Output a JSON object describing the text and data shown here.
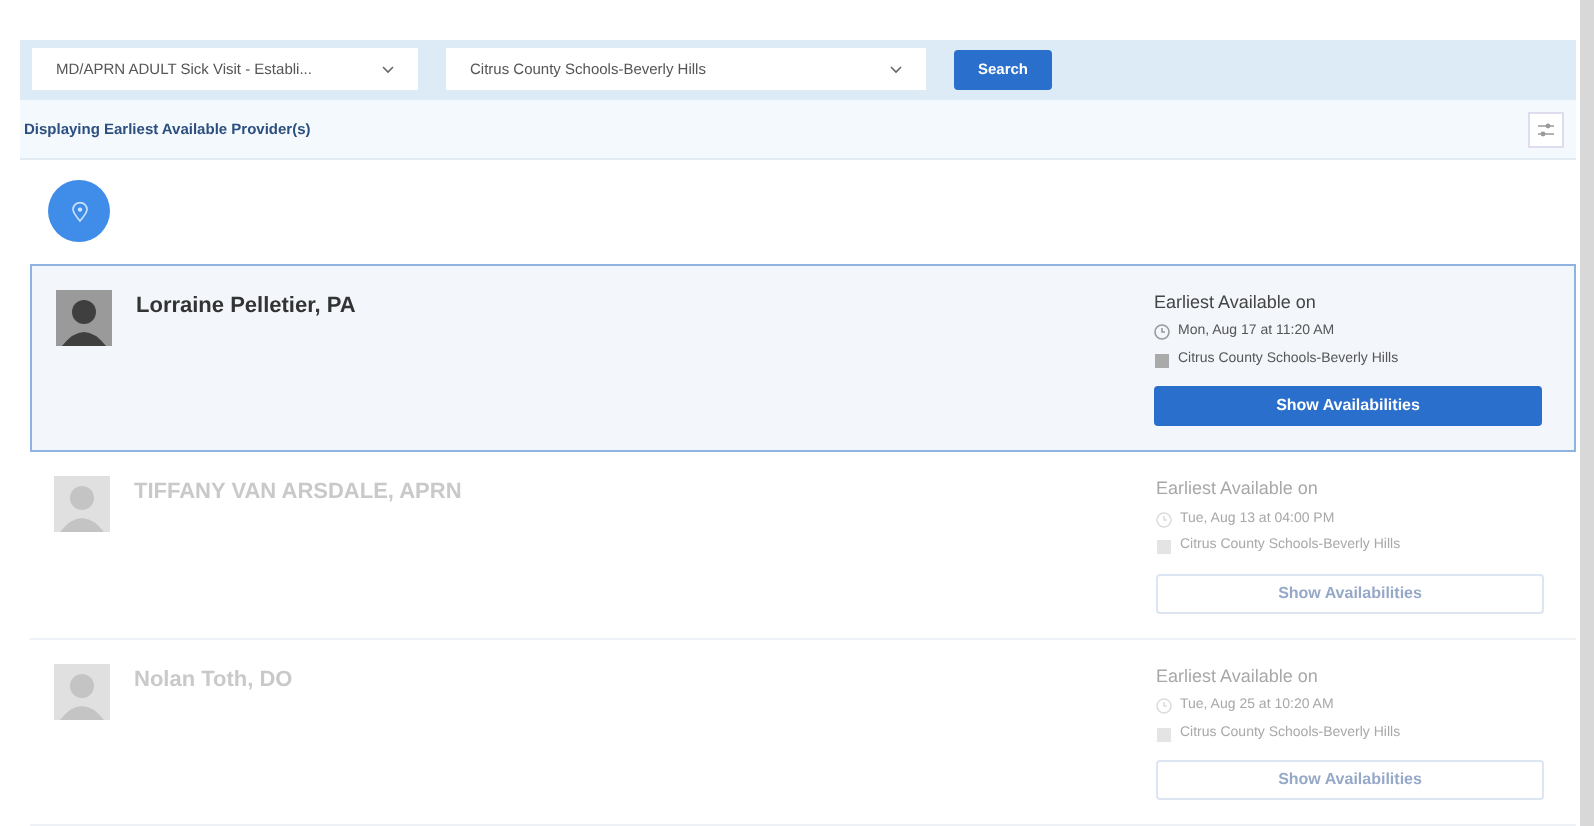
{
  "filters": {
    "visit_type": "MD/APRN ADULT Sick Visit - Establi...",
    "location": "Citrus County Schools-Beverly Hills",
    "search_button": "Search"
  },
  "results_header": {
    "title": "Displaying Earliest Available Provider(s)"
  },
  "providers": [
    {
      "name": "Lorraine Pelletier, PA",
      "selected": true,
      "disabled": false,
      "earliest_label": "Earliest Available on",
      "date": "Mon, Aug 17 at 11:20 AM",
      "location": "Citrus County Schools-Beverly Hills",
      "button": "Show Availabilities"
    },
    {
      "name": "TIFFANY VAN ARSDALE, APRN",
      "selected": false,
      "disabled": true,
      "earliest_label": "Earliest Available on",
      "date": "Tue, Aug 13 at 04:00 PM",
      "location": "Citrus County Schools-Beverly Hills",
      "button": "Show Availabilities"
    },
    {
      "name": "Nolan Toth, DO",
      "selected": false,
      "disabled": true,
      "earliest_label": "Earliest Available on",
      "date": "Tue, Aug 25 at 10:20 AM",
      "location": "Citrus County Schools-Beverly Hills",
      "button": "Show Availabilities"
    }
  ]
}
